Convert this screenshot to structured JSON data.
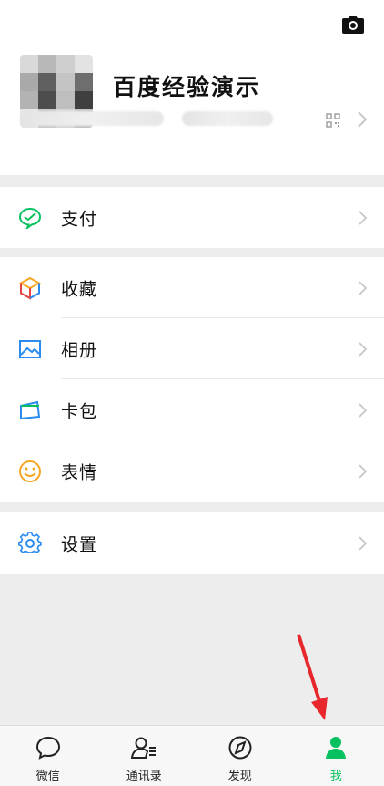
{
  "profile": {
    "name": "百度经验演示",
    "camera_icon": "camera-icon",
    "qr_icon": "qr-code-icon"
  },
  "menu": {
    "pay": {
      "label": "支付",
      "icon": "wechat-pay-icon",
      "color": "#07c160"
    },
    "favorites": {
      "label": "收藏",
      "icon": "cube-icon"
    },
    "album": {
      "label": "相册",
      "icon": "photo-icon",
      "color": "#2b8cf0"
    },
    "cards": {
      "label": "卡包",
      "icon": "wallet-icon",
      "color": "#2b8cf0"
    },
    "stickers": {
      "label": "表情",
      "icon": "smile-icon",
      "color": "#f5a623"
    },
    "settings": {
      "label": "设置",
      "icon": "gear-icon",
      "color": "#2b8cf0"
    }
  },
  "tabbar": {
    "tabs": [
      {
        "label": "微信",
        "icon": "chat-bubble-icon"
      },
      {
        "label": "通讯录",
        "icon": "contacts-icon"
      },
      {
        "label": "发现",
        "icon": "compass-icon"
      },
      {
        "label": "我",
        "icon": "person-icon",
        "active": true
      }
    ],
    "active_color": "#07c160"
  },
  "annotation": {
    "arrow_color": "#e8272c"
  }
}
